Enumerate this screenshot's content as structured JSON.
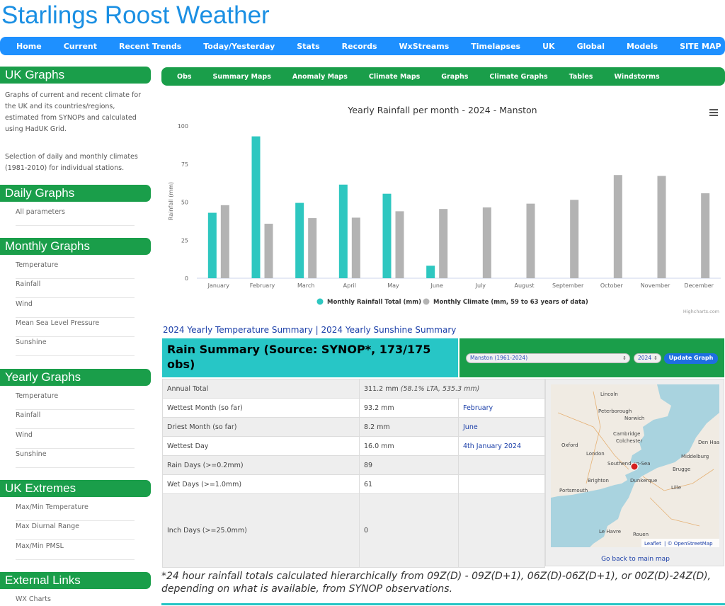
{
  "site": {
    "title": "Starlings Roost Weather"
  },
  "topnav": [
    "Home",
    "Current",
    "Recent Trends",
    "Today/Yesterday",
    "Stats",
    "Records",
    "WxStreams",
    "Timelapses",
    "UK",
    "Global",
    "Models",
    "SITE MAP"
  ],
  "sidebar": {
    "uk_graphs": {
      "heading": "UK Graphs",
      "text1": "Graphs of current and recent climate for the UK and its countries/regions, estimated from SYNOPs and calculated using HadUK Grid.",
      "text2": "Selection of daily and monthly climates (1981-2010) for individual stations."
    },
    "daily": {
      "heading": "Daily Graphs",
      "items": [
        "All parameters"
      ]
    },
    "monthly": {
      "heading": "Monthly Graphs",
      "items": [
        "Temperature",
        "Rainfall",
        "Wind",
        "Mean Sea Level Pressure",
        "Sunshine"
      ]
    },
    "yearly": {
      "heading": "Yearly Graphs",
      "items": [
        "Temperature",
        "Rainfall",
        "Wind",
        "Sunshine"
      ]
    },
    "extremes": {
      "heading": "UK Extremes",
      "items": [
        "Max/Min Temperature",
        "Max Diurnal Range",
        "Max/Min PMSL"
      ]
    },
    "external": {
      "heading": "External Links",
      "items": [
        "WX Charts"
      ]
    }
  },
  "subnav": [
    "Obs",
    "Summary Maps",
    "Anomaly Maps",
    "Climate Maps",
    "Graphs",
    "Climate Graphs",
    "Tables",
    "Windstorms"
  ],
  "chart_data": {
    "type": "bar",
    "title": "Yearly Rainfall per month - 2024 - Manston",
    "ylabel": "Rainfall (mm)",
    "xlabel": "",
    "ylim": [
      0,
      100
    ],
    "yticks": [
      0,
      25,
      50,
      75,
      100
    ],
    "grid": false,
    "legend": "bottom-center",
    "categories": [
      "January",
      "February",
      "March",
      "April",
      "May",
      "June",
      "July",
      "August",
      "September",
      "October",
      "November",
      "December"
    ],
    "series": [
      {
        "name": "Monthly Rainfall Total (mm)",
        "color": "#2ec7c0",
        "values": [
          43.0,
          93.2,
          49.5,
          61.5,
          55.5,
          8.2,
          null,
          null,
          null,
          null,
          null,
          null
        ]
      },
      {
        "name": "Monthly Climate (mm, 59 to 63 years of data)",
        "color": "#b3b3b3",
        "values": [
          48.0,
          35.8,
          39.5,
          39.8,
          44.0,
          45.5,
          46.5,
          49.0,
          51.5,
          67.8,
          67.2,
          55.8
        ]
      }
    ],
    "credit": "Highcharts.com"
  },
  "summary_links": {
    "temperature": "2024 Yearly Temperature Summary",
    "separator": "|",
    "sunshine": "2024 Yearly Sunshine Summary"
  },
  "rain_summary": {
    "heading": "Rain Summary (Source: SYNOP*, 173/175 obs)",
    "station_select": "Manston (1961-2024)",
    "year_select": "2024",
    "update_button": "Update Graph",
    "rows": [
      {
        "label": "Annual Total",
        "value": "311.2 mm",
        "note": "(58.1% LTA, 535.3 mm)"
      },
      {
        "label": "Wettest Month (so far)",
        "value": "93.2 mm",
        "link": "February"
      },
      {
        "label": "Driest Month (so far)",
        "value": "8.2 mm",
        "link": "June"
      },
      {
        "label": "Wettest Day",
        "value": "16.0 mm",
        "link": "4th January 2024"
      },
      {
        "label": "Rain Days (>=0.2mm)",
        "value": "89"
      },
      {
        "label": "Wet Days (>=1.0mm)",
        "value": "61"
      },
      {
        "label": "Inch Days (>=25.0mm)",
        "value": "0"
      }
    ]
  },
  "map": {
    "labels": [
      "Lincoln",
      "Peterborough",
      "Norwich",
      "Cambridge",
      "Colchester",
      "Oxford",
      "London",
      "Southend-on-Sea",
      "Brighton",
      "Portsmouth",
      "Dunkerque",
      "Brugge",
      "Den Haag",
      "Middelburg",
      "Lille",
      "Le Havre",
      "Rouen"
    ],
    "attribution_leaflet": "Leaflet",
    "attribution_osm": "| © OpenStreetMap",
    "back_link": "Go back to main map",
    "colors": {
      "sea": "#a9d3df",
      "land": "#f0ebe3",
      "marker": "#d42020"
    }
  },
  "footnote": "*24 hour rainfall totals calculated hierarchically from 09Z(D) - 09Z(D+1), 06Z(D)-06Z(D+1), or 00Z(D)-24Z(D), depending on what is available, from SYNOP observations."
}
